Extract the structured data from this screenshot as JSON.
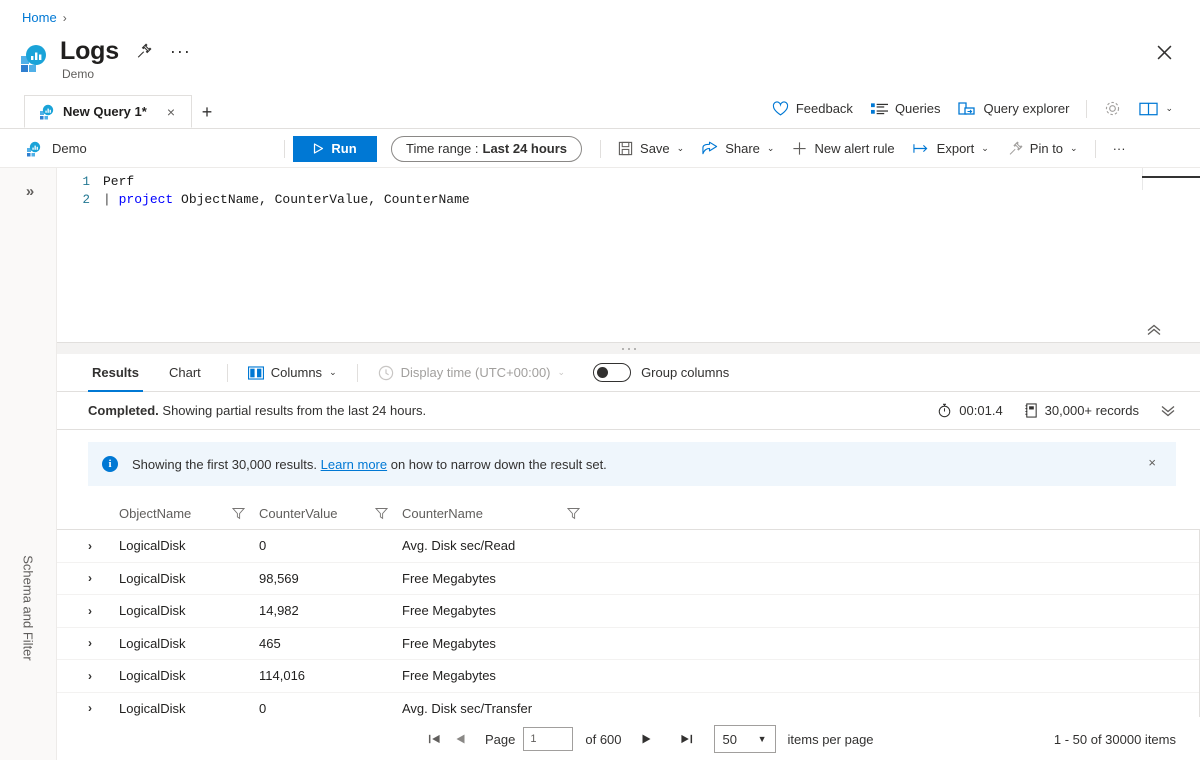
{
  "breadcrumb": {
    "home": "Home",
    "separator": "›"
  },
  "header": {
    "title": "Logs",
    "subtitle": "Demo",
    "pin_icon": "pin-icon",
    "more_icon": "ellipsis-icon",
    "close_icon": "close-icon"
  },
  "tabs": {
    "items": [
      {
        "label": "New Query 1*",
        "close": "×",
        "icon": "query-icon"
      }
    ],
    "new_tab": "+",
    "commands": [
      {
        "label": "Feedback",
        "icon": "heart-icon"
      },
      {
        "label": "Queries",
        "icon": "list-icon"
      },
      {
        "label": "Query explorer",
        "icon": "explorer-icon"
      }
    ],
    "settings_icon": "gear-icon",
    "book_icon": "book-icon",
    "book_chevron": "⌄"
  },
  "query_toolbar": {
    "scope": "Demo",
    "scope_icon": "query-icon",
    "run_label": "Run",
    "run_icon": "play-icon",
    "time_range_label": "Time range :",
    "time_range_value": "Last 24 hours",
    "actions": [
      {
        "label": "Save",
        "icon": "save-icon",
        "chevron": "⌄"
      },
      {
        "label": "Share",
        "icon": "share-icon",
        "chevron": "⌄"
      },
      {
        "label": "New alert rule",
        "icon": "plus-icon",
        "chevron": ""
      },
      {
        "label": "Export",
        "icon": "export-icon",
        "chevron": "⌄"
      },
      {
        "label": "Pin to",
        "icon": "pin-icon",
        "chevron": "⌄"
      }
    ],
    "overflow": "···"
  },
  "sidebar": {
    "expand_icon": "»",
    "vertical_label": "Schema and Filter"
  },
  "editor": {
    "lines": [
      {
        "number": "1",
        "prefix": "",
        "keyword": "",
        "rest": "Perf"
      },
      {
        "number": "2",
        "prefix": "| ",
        "keyword": "project",
        "rest": " ObjectName, CounterValue, CounterName"
      }
    ],
    "collapse_icon": "«"
  },
  "results": {
    "tabs": [
      {
        "label": "Results",
        "active": true
      },
      {
        "label": "Chart",
        "active": false
      }
    ],
    "columns_label": "Columns",
    "columns_icon": "columns-icon",
    "columns_chevron": "⌄",
    "display_time_label": "Display time (UTC+00:00)",
    "display_time_icon": "clock-icon",
    "display_time_chevron": "⌄",
    "group_columns_label": "Group columns",
    "group_columns_on": false,
    "status": {
      "bold": "Completed.",
      "text": " Showing partial results from the last 24 hours.",
      "duration": "00:01.4",
      "duration_icon": "stopwatch-icon",
      "records": "30,000+ records",
      "records_icon": "records-icon",
      "expand_icon": "ˇ"
    },
    "banner": {
      "icon": "info-icon",
      "text_before": "Showing the first 30,000 results.",
      "link": "Learn more",
      "text_after": "on how to narrow down the result set.",
      "close": "×"
    },
    "grid": {
      "columns": [
        {
          "name": "ObjectName",
          "filter_icon": "filter-icon"
        },
        {
          "name": "CounterValue",
          "filter_icon": "filter-icon"
        },
        {
          "name": "CounterName",
          "filter_icon": "filter-icon"
        }
      ],
      "expand_glyph": "›",
      "rows": [
        {
          "ObjectName": "LogicalDisk",
          "CounterValue": "0",
          "CounterName": "Avg. Disk sec/Read"
        },
        {
          "ObjectName": "LogicalDisk",
          "CounterValue": "98,569",
          "CounterName": "Free Megabytes"
        },
        {
          "ObjectName": "LogicalDisk",
          "CounterValue": "14,982",
          "CounterName": "Free Megabytes"
        },
        {
          "ObjectName": "LogicalDisk",
          "CounterValue": "465",
          "CounterName": "Free Megabytes"
        },
        {
          "ObjectName": "LogicalDisk",
          "CounterValue": "114,016",
          "CounterName": "Free Megabytes"
        },
        {
          "ObjectName": "LogicalDisk",
          "CounterValue": "0",
          "CounterName": "Avg. Disk sec/Transfer"
        }
      ]
    },
    "pager": {
      "first": "❘◀",
      "prev": "◀",
      "page_label": "Page",
      "page_value": "1",
      "of_label": "of 600",
      "next": "▶",
      "last": "▶❘",
      "page_size": "50",
      "page_size_chevron": "▼",
      "items_per_page": "items per page",
      "range": "1 - 50 of 30000 items"
    }
  },
  "colors": {
    "accent": "#0078d4",
    "link": "#0078d4",
    "banner_bg": "#eff6fc",
    "border": "#e1dfdd",
    "rail_bg": "#faf9f8"
  }
}
